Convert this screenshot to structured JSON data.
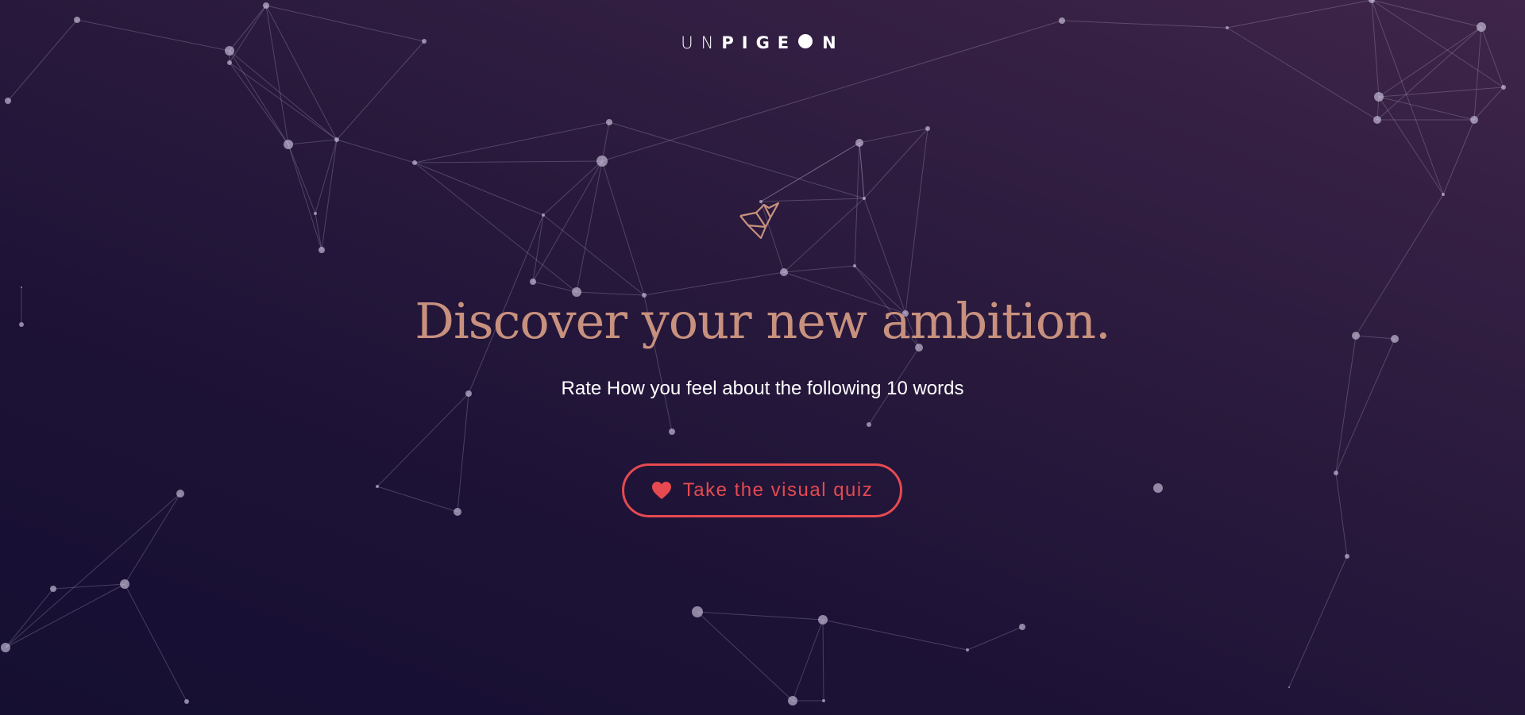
{
  "logo": {
    "light_part": "UN",
    "bold_part": "PIGE",
    "icon": "filled-circle-o-icon",
    "bold_end": "N"
  },
  "hero": {
    "title": "Discover your new ambition.",
    "subtitle": "Rate How you feel about the following 10 words"
  },
  "cta": {
    "label": "Take the visual quiz",
    "icon": "heart-icon"
  },
  "decor": {
    "bird_icon": "origami-bird-icon",
    "background": "particle-network"
  },
  "colors": {
    "accent": "#c8917e",
    "cta": "#e64a50",
    "text": "#ffffff",
    "bg_dark": "#150f32",
    "bg_light": "#3e2549"
  }
}
